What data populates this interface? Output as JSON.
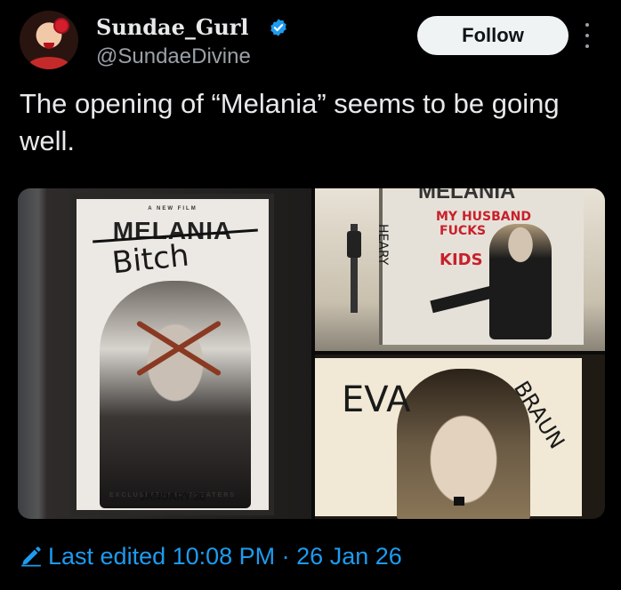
{
  "header": {
    "display_name": "Sundae_Gurl",
    "handle": "@SundaeDivine",
    "follow_label": "Follow",
    "verified_icon": "verified-badge-icon",
    "more_icon": "more-vertical-icon"
  },
  "tweet": {
    "text": "The opening of “Melania” seems to be going well."
  },
  "media": {
    "poster1": {
      "tagline": "A NEW FILM",
      "title": "MELANIA",
      "graffiti": "Bitch",
      "release_small": "EXCLUSIVELY IN THEATERS",
      "release_date": "JANUARY 30"
    },
    "poster2": {
      "title": "MELANIA",
      "graffiti_line1": "MY HUSBAND",
      "graffiti_line2": "FUCKS",
      "graffiti_line3": "KIDS",
      "side_tag": "HEARY"
    },
    "poster3": {
      "graffiti_left": "EVA",
      "graffiti_right": "BRAUN"
    }
  },
  "footer": {
    "edited_label": "Last edited 10:08 PM · 26 Jan 26",
    "edit_icon": "pencil-icon"
  },
  "colors": {
    "background": "#000000",
    "text": "#e7e9ea",
    "secondary": "#9aa0a6",
    "link": "#1d9bf0",
    "verified": "#1d9bf0",
    "follow_bg": "#eff3f4"
  }
}
